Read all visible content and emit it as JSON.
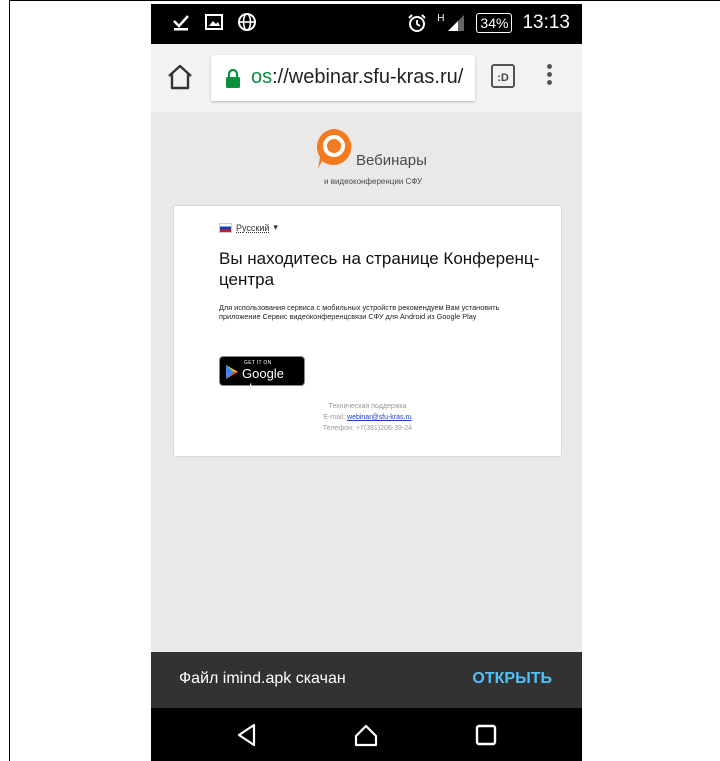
{
  "status_bar": {
    "icons_left": [
      "download-done-icon",
      "image-icon",
      "globe-icon"
    ],
    "icons_right": [
      "alarm-icon",
      "signal-icon"
    ],
    "network_label": "H",
    "battery": "34%",
    "time": "13:13"
  },
  "browser": {
    "url_scheme": "os",
    "url_rest": "://webinar.sfu-kras.ru/",
    "tab_count_label": ":D"
  },
  "page": {
    "logo": {
      "title": "Вебинары",
      "subtitle": "и видеоконференции СФУ"
    },
    "card": {
      "language": "Русский",
      "heading": "Вы находитесь на странице Конференц-центра",
      "description": "Для использования сервиса с мобильных устройств рекомендуем Вам установить приложение Сервис видеоконференцсвязи СФУ для Android из Google Play",
      "badge_small": "GET IT ON",
      "badge_large": "Google play",
      "support_title": "Техническая поддержка",
      "support_email_label": "E-mail:",
      "support_email": "webinar@sfu-kras.ru",
      "support_phone": "Телефон: +7(391)206-39-24"
    }
  },
  "snackbar": {
    "message": "Файл imind.apk скачан",
    "action": "ОТКРЫТЬ"
  },
  "colors": {
    "logo_orange": "#f47a1f",
    "snackbar_action": "#4fc3f7",
    "lock_green": "#0a8f3c"
  }
}
